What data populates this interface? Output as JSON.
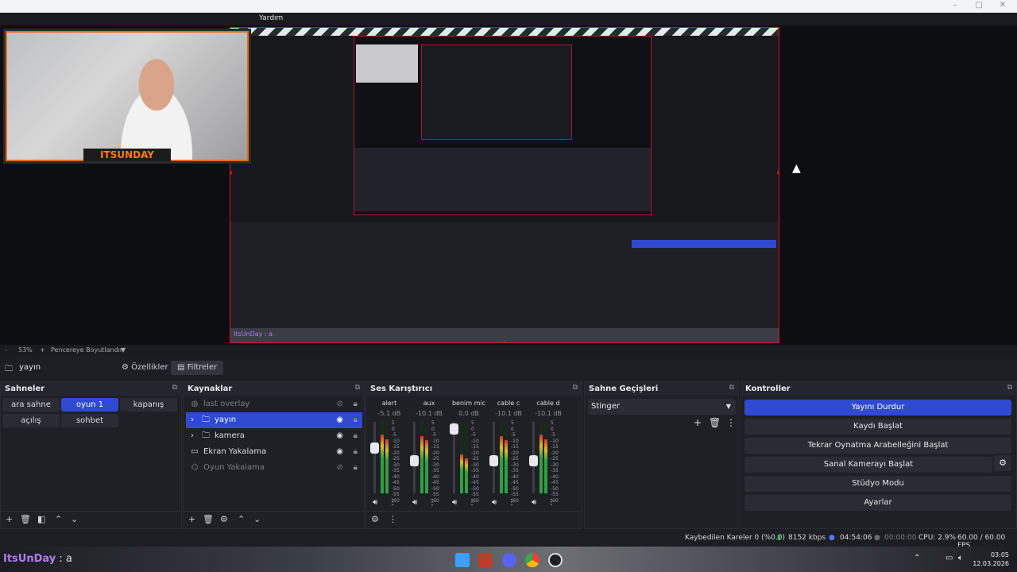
{
  "menu": {
    "help": "Yardım"
  },
  "webcam": {
    "channel_logo": "ITSUNDAY"
  },
  "inner_preview": {
    "taskbar_user": "ItsUnDay : a"
  },
  "zoom": {
    "minus": "-",
    "value": "53%",
    "plus": "+",
    "fit_label": "Pencereye Boyutlandır"
  },
  "scene_bar": {
    "current_scene": "yayın",
    "properties_label": "Özellikler",
    "filters_label": "Filtreler"
  },
  "scenes": {
    "title": "Sahneler",
    "items": [
      "ara sahne",
      "oyun 1",
      "kapanış",
      "açılış",
      "sohbet"
    ],
    "active": "oyun 1"
  },
  "sources": {
    "title": "Kaynaklar",
    "items": [
      {
        "label": "last overlay",
        "icon": "globe-icon"
      },
      {
        "label": "yayın",
        "icon": "folder-icon"
      },
      {
        "label": "kamera",
        "icon": "folder-icon"
      },
      {
        "label": "Ekran Yakalama",
        "icon": "monitor-icon"
      },
      {
        "label": "Oyun Yakalama",
        "icon": "gamepad-icon"
      }
    ]
  },
  "mixer": {
    "title": "Ses Karıştırıcı",
    "channels": [
      {
        "name": "alert",
        "db": "-5.1 dB",
        "level": 0.82,
        "fader": 0.66
      },
      {
        "name": "aux",
        "db": "-10.1 dB",
        "level": 0.8,
        "fader": 0.45
      },
      {
        "name": "benim mic",
        "db": "0.0 dB",
        "level": 0.55,
        "fader": 0.98
      },
      {
        "name": "cable c",
        "db": "-10.1 dB",
        "level": 0.8,
        "fader": 0.45
      },
      {
        "name": "cable d",
        "db": "-10.1 dB",
        "level": 0.82,
        "fader": 0.45
      }
    ],
    "scale": [
      "5",
      "0",
      "-5",
      "-10",
      "-15",
      "-20",
      "-25",
      "-30",
      "-35",
      "-40",
      "-45",
      "-50",
      "-55",
      "-60"
    ]
  },
  "transitions": {
    "title": "Sahne Geçişleri",
    "selected": "Stinger"
  },
  "controls": {
    "title": "Kontroller",
    "stop_stream": "Yayını Durdur",
    "start_record": "Kaydı Başlat",
    "replay_buffer": "Tekrar Oynatma Arabelleğini Başlat",
    "virtual_cam": "Sanal Kamerayı Başlat",
    "studio_mode": "Stüdyo Modu",
    "settings": "Ayarlar"
  },
  "status": {
    "dropped_frames": "Kaybedilen Kareler 0 (%0.0)",
    "bitrate": "8152 kbps",
    "stream_time": "04:54:06",
    "record_time": "00:00:00",
    "cpu": "CPU: 2.9%",
    "fps": "60.00 / 60.00 FPS"
  },
  "taskbar": {
    "user": "ItsUnDay",
    "message": ": a",
    "time": "03:05",
    "date": "12.03.2026"
  },
  "colors": {
    "accent": "#2f4ad0",
    "border_red": "#d0142a",
    "brand_orange": "#e46a1c",
    "chat_purple": "#b07cf0"
  }
}
